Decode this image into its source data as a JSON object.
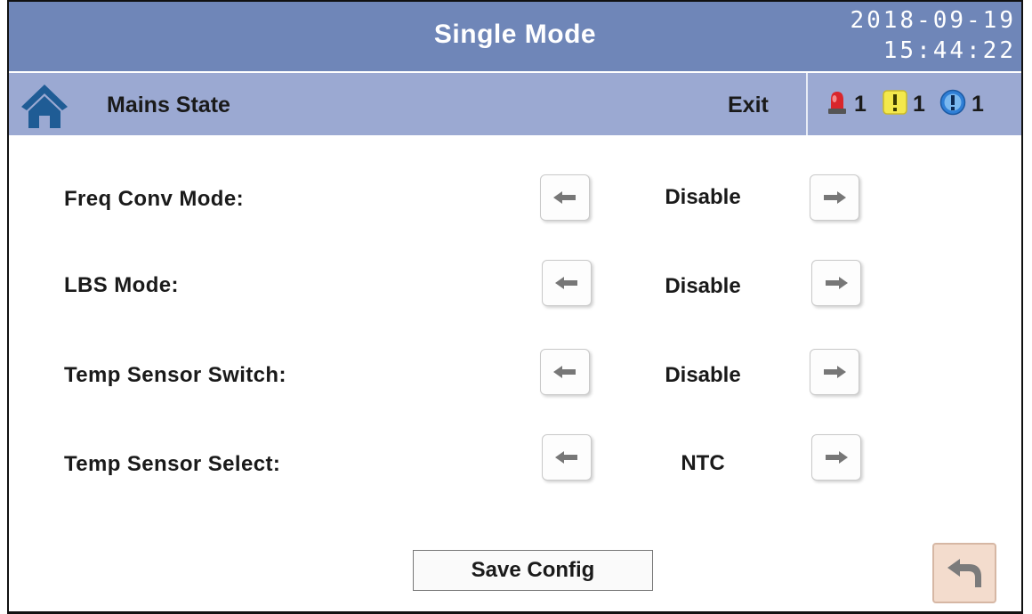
{
  "header": {
    "title": "Single Mode",
    "date": "2018-09-19",
    "time": "15:44:22"
  },
  "subheader": {
    "page_label": "Mains State",
    "exit_label": "Exit",
    "alarms": [
      {
        "icon": "red-alarm-light-icon",
        "count": "1",
        "color": "#d9262b"
      },
      {
        "icon": "yellow-warning-icon",
        "count": "1",
        "color": "#f3e84c"
      },
      {
        "icon": "blue-info-icon",
        "count": "1",
        "color": "#2f7fd6"
      }
    ]
  },
  "settings": [
    {
      "label": "Freq Conv Mode:",
      "value": "Disable"
    },
    {
      "label": "LBS Mode:",
      "value": "Disable"
    },
    {
      "label": "Temp Sensor Switch:",
      "value": "Disable"
    },
    {
      "label": "Temp Sensor Select:",
      "value": "NTC"
    }
  ],
  "footer": {
    "save_label": "Save Config",
    "back_icon": "undo-arrow-icon"
  },
  "colors": {
    "title_bar": "#6f86b8",
    "sub_bar": "#9ba9d2",
    "home_icon": "#1f5c95",
    "arrow_glyph": "#777777",
    "back_button": "#f3dccd"
  }
}
